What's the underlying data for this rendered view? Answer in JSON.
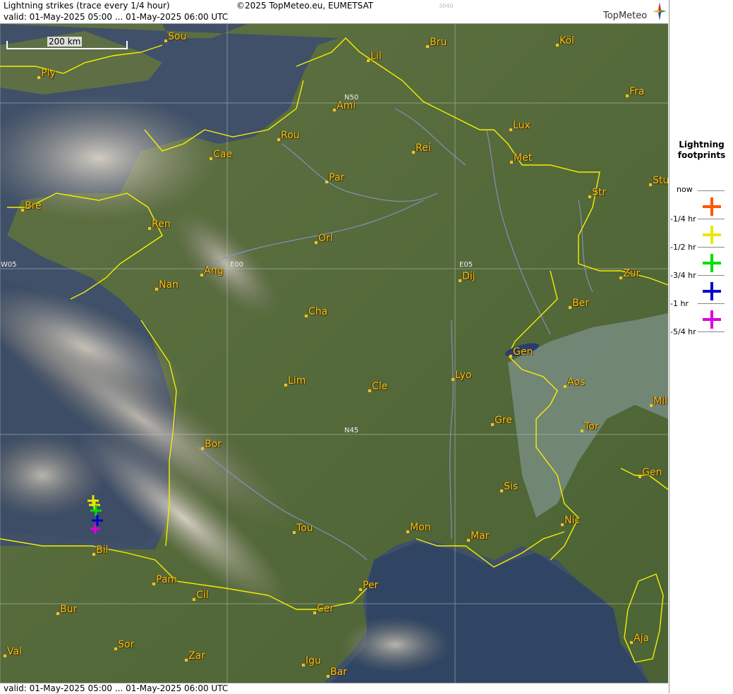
{
  "header": {
    "title": "Lightning strikes (trace every 1/4 hour)",
    "copyright": "©2025 TopMeteo.eu, EUMETSAT",
    "code": "3040",
    "valid": "valid:  01-May-2025 05:00 ... 01-May-2025 06:00 UTC",
    "brand": "TopMeteo"
  },
  "footer": {
    "valid": "valid:  01-May-2025 05:00 ... 01-May-2025 06:00 UTC"
  },
  "scale": {
    "label": "200 km"
  },
  "grid_labels": {
    "n50": "N50",
    "n45": "N45",
    "e00": "E00",
    "e05": "E05",
    "w05": "W05"
  },
  "legend": {
    "title_line1": "Lightning",
    "title_line2": "footprints",
    "rows": [
      {
        "label": "now",
        "color": "#ff5500"
      },
      {
        "label": "-1/4 hr",
        "color": "#e8e800"
      },
      {
        "label": "-1/2 hr",
        "color": "#00dd00"
      },
      {
        "label": "-3/4 hr",
        "color": "#0000cc"
      },
      {
        "label": "-1 hr",
        "color": "#dd00dd"
      },
      {
        "label": "-5/4 hr",
        "color": ""
      }
    ]
  },
  "cities": [
    {
      "name": "Sou"
    },
    {
      "name": "Lil"
    },
    {
      "name": "Bru"
    },
    {
      "name": "Köl"
    },
    {
      "name": "Ply"
    },
    {
      "name": "Ami"
    },
    {
      "name": "Fra"
    },
    {
      "name": "Lux"
    },
    {
      "name": "Rou"
    },
    {
      "name": "Cae"
    },
    {
      "name": "Rei"
    },
    {
      "name": "Met"
    },
    {
      "name": "Par"
    },
    {
      "name": "Stu"
    },
    {
      "name": "Str"
    },
    {
      "name": "Bre"
    },
    {
      "name": "Ren"
    },
    {
      "name": "Orl"
    },
    {
      "name": "Ang"
    },
    {
      "name": "Dij"
    },
    {
      "name": "Zür"
    },
    {
      "name": "Nan"
    },
    {
      "name": "Ber"
    },
    {
      "name": "Cha"
    },
    {
      "name": "Gen"
    },
    {
      "name": "Lim"
    },
    {
      "name": "Cle"
    },
    {
      "name": "Lyo"
    },
    {
      "name": "Aos"
    },
    {
      "name": "Mil"
    },
    {
      "name": "Gre"
    },
    {
      "name": "Tor"
    },
    {
      "name": "Bor"
    },
    {
      "name": "Gen"
    },
    {
      "name": "Sis"
    },
    {
      "name": "Nic"
    },
    {
      "name": "Tou"
    },
    {
      "name": "Mon"
    },
    {
      "name": "Mar"
    },
    {
      "name": "Bil"
    },
    {
      "name": "Pam"
    },
    {
      "name": "Per"
    },
    {
      "name": "Cil"
    },
    {
      "name": "Cer"
    },
    {
      "name": "Bur"
    },
    {
      "name": "Aja"
    },
    {
      "name": "Sor"
    },
    {
      "name": "Val"
    },
    {
      "name": "Zar"
    },
    {
      "name": "Igu"
    },
    {
      "name": "Bar"
    }
  ],
  "strike_cluster": {
    "colors": [
      "#e8e800",
      "#00dd00",
      "#0000cc",
      "#dd00dd"
    ]
  }
}
